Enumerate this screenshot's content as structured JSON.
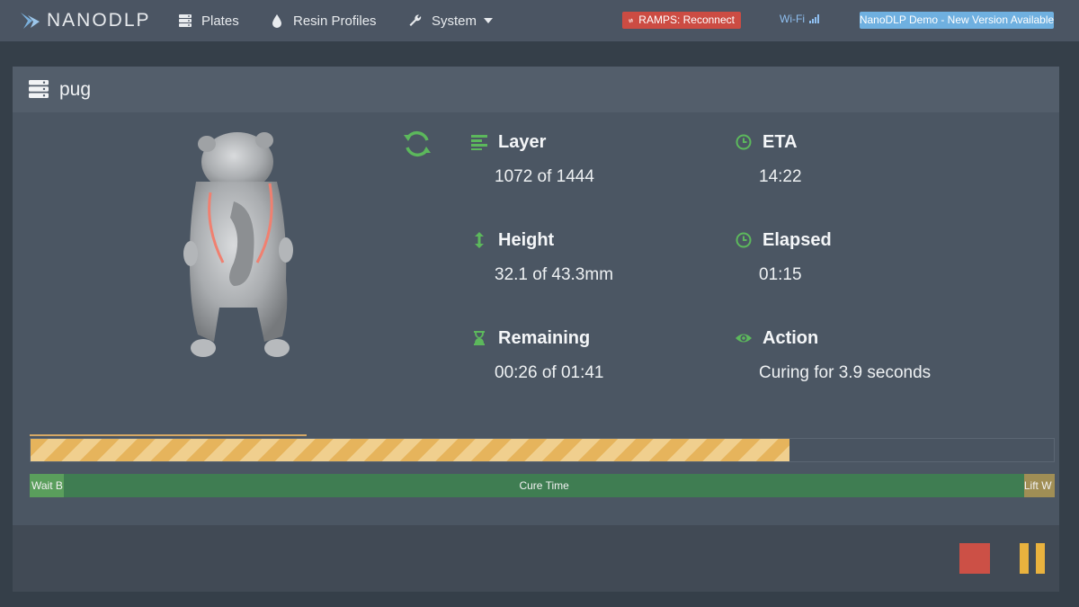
{
  "nav": {
    "brand": "NANODLP",
    "plates": "Plates",
    "resin_profiles": "Resin Profiles",
    "system": "System",
    "ramps_badge": "RAMPS: Reconnect",
    "wifi": "Wi-Fi",
    "demo_badge": "NanoDLP Demo - New Version Available"
  },
  "panel": {
    "title": "pug"
  },
  "stats": {
    "layer": {
      "label": "Layer",
      "value": "1072 of 1444"
    },
    "eta": {
      "label": "ETA",
      "value": "14:22"
    },
    "height": {
      "label": "Height",
      "value": "32.1 of 43.3mm"
    },
    "elapsed": {
      "label": "Elapsed",
      "value": "01:15"
    },
    "remaining": {
      "label": "Remaining",
      "value": "00:26 of 01:41"
    },
    "action": {
      "label": "Action",
      "value": "Curing for 3.9 seconds"
    }
  },
  "progress": {
    "layer_fraction": 0.742,
    "thin_fraction": 0.27
  },
  "phases": {
    "wait": {
      "label": "Wait B",
      "fraction": 0.032
    },
    "cure": {
      "label": "Cure Time",
      "fraction": 0.938
    },
    "lift": {
      "label": "Lift W",
      "fraction": 0.03
    }
  },
  "colors": {
    "accent_green": "#5cb85c",
    "danger": "#cc5046",
    "warning": "#e9b23e",
    "info": "#6fb0e0"
  },
  "icons": {
    "plates": "server-icon",
    "resin": "drop-icon",
    "system": "wrench-icon",
    "sync": "refresh-icon",
    "layer": "align-left-icon",
    "eta": "clock-icon",
    "height": "vertical-arrows-icon",
    "elapsed": "clock-icon",
    "remaining": "hourglass-icon",
    "action": "eye-icon"
  }
}
